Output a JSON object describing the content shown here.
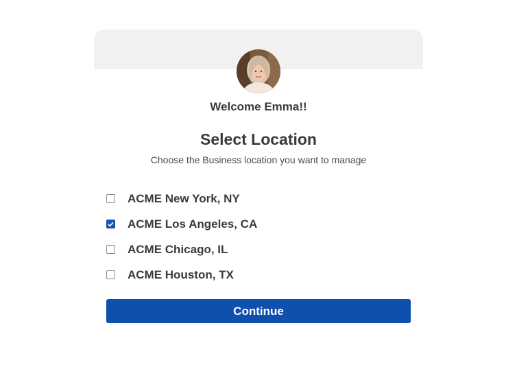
{
  "profile": {
    "avatar_icon": "user-photo-avatar",
    "welcome_text": "Welcome Emma!!"
  },
  "main": {
    "title": "Select Location",
    "subtitle": "Choose the Business location you want to manage"
  },
  "locations": [
    {
      "label": "ACME New York, NY",
      "checked": false
    },
    {
      "label": "ACME Los Angeles, CA",
      "checked": true
    },
    {
      "label": "ACME Chicago, IL",
      "checked": false
    },
    {
      "label": "ACME Houston, TX",
      "checked": false
    }
  ],
  "actions": {
    "continue_label": "Continue"
  },
  "colors": {
    "accent": "#0f4fad",
    "header_band": "#f1f1f1",
    "text": "#3a3a3a"
  }
}
